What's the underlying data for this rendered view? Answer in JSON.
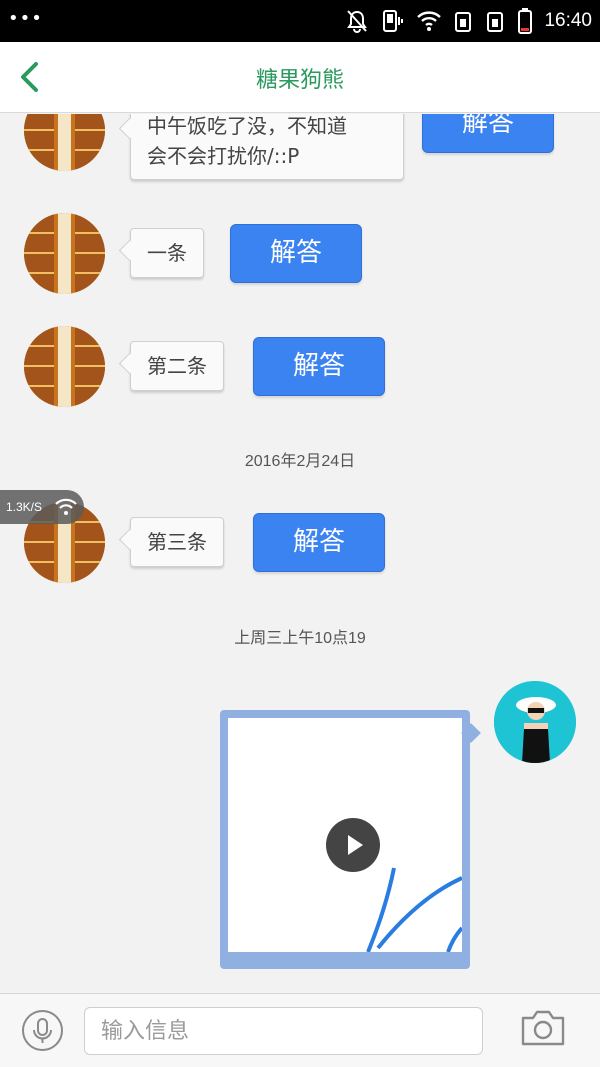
{
  "status_bar": {
    "menu_dots": "•••",
    "time": "16:40"
  },
  "header": {
    "title": "糖果狗熊",
    "back_icon": "chevron-left-icon"
  },
  "messages": [
    {
      "line1": "中午饭吃了没，不知道",
      "line2": "会不会打扰你/::P",
      "button": "解答"
    },
    {
      "text": "一条",
      "button": "解答"
    },
    {
      "text": "第二条",
      "button": "解答"
    },
    {
      "text": "第三条",
      "button": "解答"
    }
  ],
  "timestamps": [
    "2016年2月24日",
    "上周三上午10点19"
  ],
  "network_badge": {
    "speed": "1.3K/S"
  },
  "input_bar": {
    "placeholder": "输入信息",
    "mic_icon": "microphone-icon",
    "camera_icon": "camera-icon"
  },
  "colors": {
    "accent_green": "#2a9a5e",
    "button_blue": "#3b83f0",
    "video_border": "#8fb0e0"
  }
}
